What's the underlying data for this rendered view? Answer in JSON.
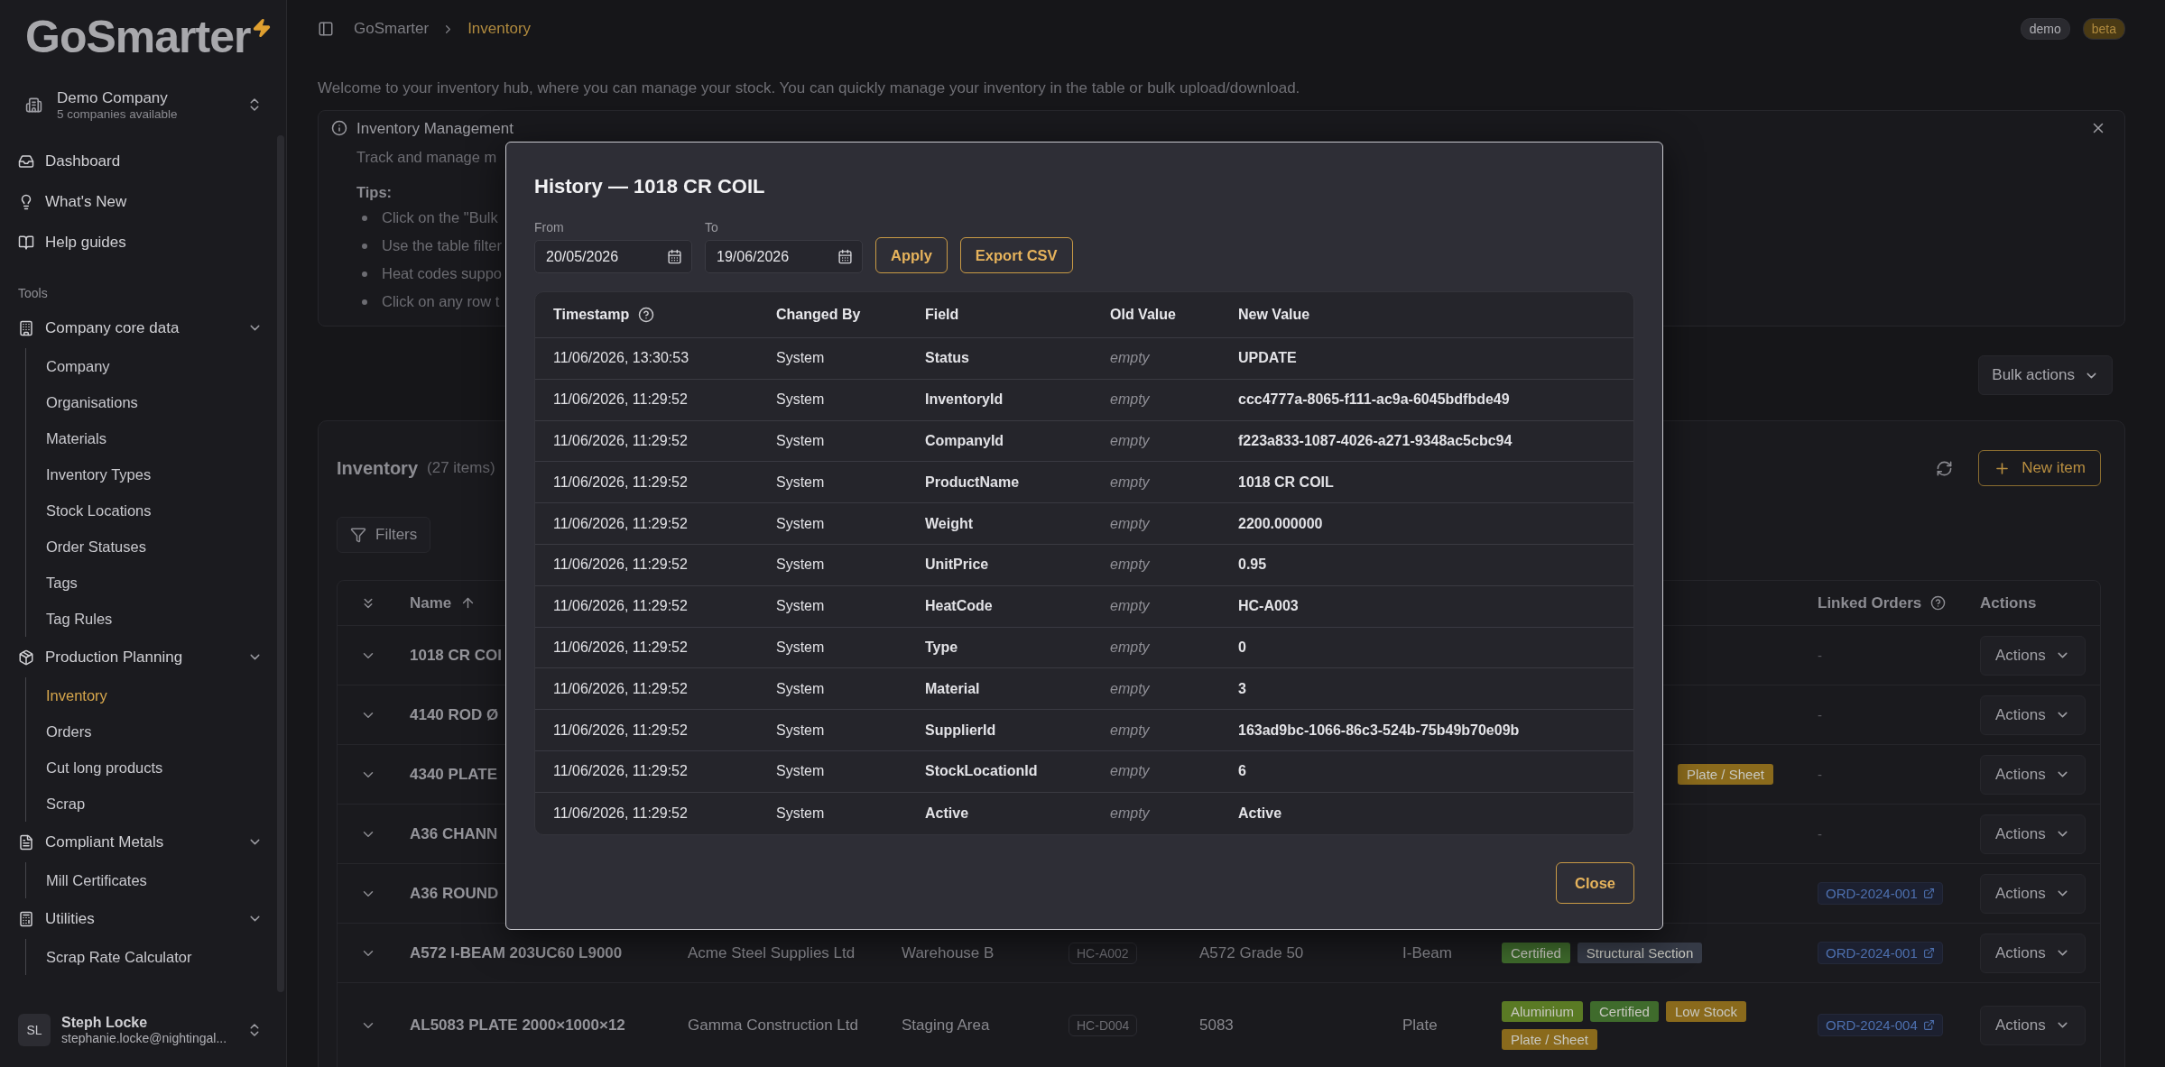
{
  "sidebar": {
    "logo": "GoSmarter",
    "company": {
      "name": "Demo Company",
      "subtitle": "5 companies available"
    },
    "nav": [
      {
        "label": "Dashboard",
        "selected": false
      },
      {
        "label": "What's New",
        "selected": false
      },
      {
        "label": "Help guides",
        "selected": false
      }
    ],
    "section_label": "Tools",
    "groups": [
      {
        "label": "Company core data",
        "expanded": true,
        "children": [
          {
            "label": "Company",
            "selected": false
          },
          {
            "label": "Organisations",
            "selected": false
          },
          {
            "label": "Materials",
            "selected": false
          },
          {
            "label": "Inventory Types",
            "selected": false
          },
          {
            "label": "Stock Locations",
            "selected": false
          },
          {
            "label": "Order Statuses",
            "selected": false
          },
          {
            "label": "Tags",
            "selected": false
          },
          {
            "label": "Tag Rules",
            "selected": false
          }
        ]
      },
      {
        "label": "Production Planning",
        "expanded": true,
        "children": [
          {
            "label": "Inventory",
            "selected": true
          },
          {
            "label": "Orders",
            "selected": false
          },
          {
            "label": "Cut long products",
            "selected": false
          },
          {
            "label": "Scrap",
            "selected": false
          }
        ]
      },
      {
        "label": "Compliant Metals",
        "expanded": true,
        "children": [
          {
            "label": "Mill Certificates",
            "selected": false
          }
        ]
      },
      {
        "label": "Utilities",
        "expanded": true,
        "children": [
          {
            "label": "Scrap Rate Calculator",
            "selected": false
          }
        ]
      }
    ],
    "user": {
      "initials": "SL",
      "name": "Steph Locke",
      "email": "stephanie.locke@nightingal..."
    }
  },
  "topbar": {
    "breadcrumb": [
      "GoSmarter",
      "Inventory"
    ],
    "badges": [
      {
        "label": "demo",
        "color": "#2a2a2f"
      },
      {
        "label": "beta",
        "color": "#4a3a14"
      }
    ]
  },
  "intro": "Welcome to your inventory hub, where you can manage your stock. You can quickly manage your inventory in the table or bulk upload/download.",
  "info": {
    "title": "Inventory Management",
    "text": "Track and manage m",
    "tips_label": "Tips:",
    "tips": [
      "Click on the \"Bulk",
      "Use the table filter",
      "Heat codes suppo",
      "Click on any row t"
    ]
  },
  "bulk_actions": "Bulk actions",
  "inventory": {
    "title": "Inventory",
    "count": "(27 items)",
    "new_item": "New item",
    "filters": "Filters",
    "columns": {
      "name": "Name",
      "linked_orders": "Linked Orders",
      "actions": "Actions"
    },
    "rows": [
      {
        "name": "1018 CR COI",
        "tags": [],
        "linked_order": {
          "label": "-",
          "kind": "none"
        },
        "action": "Actions"
      },
      {
        "name": "4140 ROD Ø",
        "tags": [],
        "linked_order": {
          "label": "-",
          "kind": "none"
        },
        "action": "Actions"
      },
      {
        "name": "4340 PLATE",
        "tags": [
          {
            "label": "Plate / Sheet",
            "color": "#8a6a1c"
          }
        ],
        "linked_order": {
          "label": "-",
          "kind": "none"
        },
        "action": "Actions"
      },
      {
        "name": "A36 CHANN",
        "tags": [],
        "linked_order": {
          "label": "-",
          "kind": "none"
        },
        "action": "Actions"
      },
      {
        "name": "A36 ROUND",
        "tags": [],
        "linked_order": {
          "label": "ORD-2024-001",
          "kind": "link"
        },
        "action": "Actions"
      },
      {
        "name": "A572 I-BEAM 203UC60 L9000",
        "supplier": "Acme Steel Supplies Ltd",
        "location": "Warehouse B",
        "heat_code": "HC-A002",
        "grade": "A572 Grade 50",
        "type": "I-Beam",
        "tags": [
          {
            "label": "Certified",
            "color": "#3f6b2c"
          },
          {
            "label": "Structural Section",
            "color": "#363b47"
          }
        ],
        "linked_order": {
          "label": "ORD-2024-001",
          "kind": "link"
        },
        "action": "Actions"
      },
      {
        "name": "AL5083 PLATE 2000×1000×12",
        "supplier": "Gamma Construction Ltd",
        "location": "Staging Area",
        "heat_code": "HC-D004",
        "grade": "5083",
        "type": "Plate",
        "tags": [
          {
            "label": "Aluminium",
            "color": "#5a7a24"
          },
          {
            "label": "Certified",
            "color": "#3f6b2c"
          },
          {
            "label": "Low Stock",
            "color": "#8a6a1c"
          },
          {
            "label": "Plate / Sheet",
            "color": "#8a6a1c"
          }
        ],
        "linked_order": {
          "label": "ORD-2024-004",
          "kind": "link"
        },
        "action": "Actions"
      }
    ]
  },
  "modal": {
    "title": "History — 1018 CR COIL",
    "from_label": "From",
    "from": "20/05/2026",
    "to_label": "To",
    "to": "19/06/2026",
    "apply": "Apply",
    "export": "Export CSV",
    "columns": [
      "Timestamp",
      "Changed By",
      "Field",
      "Old Value",
      "New Value"
    ],
    "rows": [
      {
        "timestamp": "11/06/2026, 13:30:53",
        "changed_by": "System",
        "field": "Status",
        "old_value": "empty",
        "new_value": "UPDATE"
      },
      {
        "timestamp": "11/06/2026, 11:29:52",
        "changed_by": "System",
        "field": "InventoryId",
        "old_value": "empty",
        "new_value": "ccc4777a-8065-f111-ac9a-6045bdfbde49"
      },
      {
        "timestamp": "11/06/2026, 11:29:52",
        "changed_by": "System",
        "field": "CompanyId",
        "old_value": "empty",
        "new_value": "f223a833-1087-4026-a271-9348ac5cbc94"
      },
      {
        "timestamp": "11/06/2026, 11:29:52",
        "changed_by": "System",
        "field": "ProductName",
        "old_value": "empty",
        "new_value": "1018 CR COIL"
      },
      {
        "timestamp": "11/06/2026, 11:29:52",
        "changed_by": "System",
        "field": "Weight",
        "old_value": "empty",
        "new_value": "2200.000000"
      },
      {
        "timestamp": "11/06/2026, 11:29:52",
        "changed_by": "System",
        "field": "UnitPrice",
        "old_value": "empty",
        "new_value": "0.95"
      },
      {
        "timestamp": "11/06/2026, 11:29:52",
        "changed_by": "System",
        "field": "HeatCode",
        "old_value": "empty",
        "new_value": "HC-A003"
      },
      {
        "timestamp": "11/06/2026, 11:29:52",
        "changed_by": "System",
        "field": "Type",
        "old_value": "empty",
        "new_value": "0"
      },
      {
        "timestamp": "11/06/2026, 11:29:52",
        "changed_by": "System",
        "field": "Material",
        "old_value": "empty",
        "new_value": "3"
      },
      {
        "timestamp": "11/06/2026, 11:29:52",
        "changed_by": "System",
        "field": "SupplierId",
        "old_value": "empty",
        "new_value": "163ad9bc-1066-86c3-524b-75b49b70e09b"
      },
      {
        "timestamp": "11/06/2026, 11:29:52",
        "changed_by": "System",
        "field": "StockLocationId",
        "old_value": "empty",
        "new_value": "6"
      },
      {
        "timestamp": "11/06/2026, 11:29:52",
        "changed_by": "System",
        "field": "Active",
        "old_value": "empty",
        "new_value": "Active"
      }
    ],
    "close": "Close"
  }
}
